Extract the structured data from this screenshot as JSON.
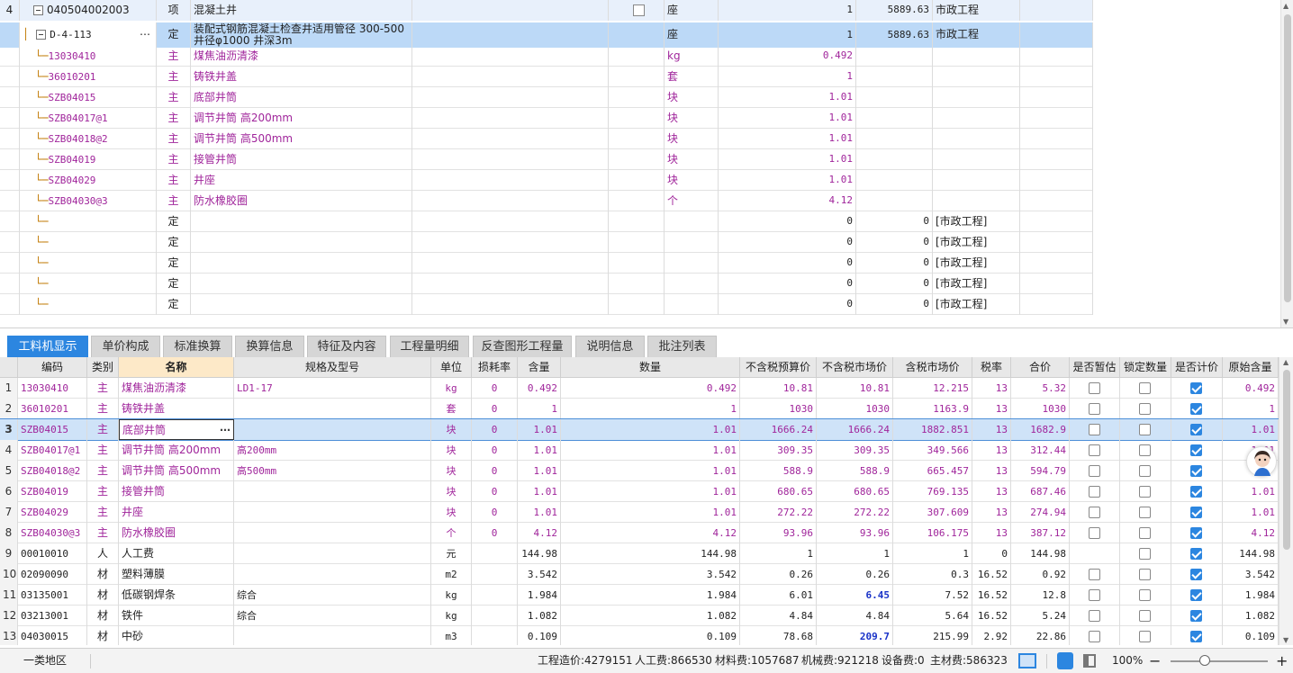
{
  "top_grid": {
    "rows": [
      {
        "no": "4",
        "code": "040504002003",
        "type": "项",
        "name": "混凝土井",
        "unit": "座",
        "qty": "1",
        "price": "5889.63",
        "category": "市政工程",
        "has_box": true,
        "kind": "parent"
      },
      {
        "no": "",
        "code": "D-4-113",
        "type": "定",
        "name_l1": "装配式钢筋混凝土检查井适用管径 300-500",
        "name_l2": "井径φ1000 井深3m",
        "unit": "座",
        "qty": "1",
        "price": "5889.63",
        "category": "市政工程",
        "kind": "selected"
      },
      {
        "code": "13030410",
        "type": "主",
        "name": "煤焦油沥清漆",
        "unit": "kg",
        "qty": "0.492",
        "kind": "mat"
      },
      {
        "code": "36010201",
        "type": "主",
        "name": "铸铁井盖",
        "unit": "套",
        "qty": "1",
        "kind": "mat"
      },
      {
        "code": "SZB04015",
        "type": "主",
        "name": "底部井筒",
        "unit": "块",
        "qty": "1.01",
        "kind": "mat"
      },
      {
        "code": "SZB04017@1",
        "type": "主",
        "name": "调节井筒 高200mm",
        "unit": "块",
        "qty": "1.01",
        "kind": "mat"
      },
      {
        "code": "SZB04018@2",
        "type": "主",
        "name": "调节井筒 高500mm",
        "unit": "块",
        "qty": "1.01",
        "kind": "mat"
      },
      {
        "code": "SZB04019",
        "type": "主",
        "name": "接管井筒",
        "unit": "块",
        "qty": "1.01",
        "kind": "mat"
      },
      {
        "code": "SZB04029",
        "type": "主",
        "name": "井座",
        "unit": "块",
        "qty": "1.01",
        "kind": "mat"
      },
      {
        "code": "SZB04030@3",
        "type": "主",
        "name": "防水橡胶圈",
        "unit": "个",
        "qty": "4.12",
        "kind": "mat"
      },
      {
        "type": "定",
        "qty": "0",
        "price": "0",
        "category": "[市政工程]",
        "kind": "empty"
      },
      {
        "type": "定",
        "qty": "0",
        "price": "0",
        "category": "[市政工程]",
        "kind": "empty"
      },
      {
        "type": "定",
        "qty": "0",
        "price": "0",
        "category": "[市政工程]",
        "kind": "empty"
      },
      {
        "type": "定",
        "qty": "0",
        "price": "0",
        "category": "[市政工程]",
        "kind": "empty"
      },
      {
        "type": "定",
        "qty": "0",
        "price": "0",
        "category": "[市政工程]",
        "kind": "empty"
      }
    ]
  },
  "tabs": [
    "工料机显示",
    "单价构成",
    "标准换算",
    "换算信息",
    "特征及内容",
    "工程量明细",
    "反查图形工程量",
    "说明信息",
    "批注列表"
  ],
  "bottom_grid": {
    "headers": [
      "编码",
      "类别",
      "名称",
      "规格及型号",
      "单位",
      "损耗率",
      "含量",
      "数量",
      "不含税预算价",
      "不含税市场价",
      "含税市场价",
      "税率",
      "合价",
      "是否暂估",
      "锁定数量",
      "是否计价",
      "原始含量"
    ],
    "rows": [
      {
        "n": "1",
        "code": "13030410",
        "cat": "主",
        "name": "煤焦油沥清漆",
        "spec": "LD1-17",
        "unit": "kg",
        "loss": "0",
        "content": "0.492",
        "qty": "0.492",
        "p1": "10.81",
        "p2": "10.81",
        "p3": "12.215",
        "tax": "13",
        "total": "5.32",
        "est": false,
        "lock": false,
        "calc": true,
        "orig": "0.492",
        "mag": true
      },
      {
        "n": "2",
        "code": "36010201",
        "cat": "主",
        "name": "铸铁井盖",
        "spec": "",
        "unit": "套",
        "loss": "0",
        "content": "1",
        "qty": "1",
        "p1": "1030",
        "p2": "1030",
        "p3": "1163.9",
        "tax": "13",
        "total": "1030",
        "est": false,
        "lock": false,
        "calc": true,
        "orig": "1",
        "mag": true
      },
      {
        "n": "3",
        "code": "SZB04015",
        "cat": "主",
        "name": "底部井筒",
        "spec": "",
        "unit": "块",
        "loss": "0",
        "content": "1.01",
        "qty": "1.01",
        "p1": "1666.24",
        "p2": "1666.24",
        "p3": "1882.851",
        "tax": "13",
        "total": "1682.9",
        "est": false,
        "lock": false,
        "calc": true,
        "orig": "1.01",
        "mag": true,
        "sel": true
      },
      {
        "n": "4",
        "code": "SZB04017@1",
        "cat": "主",
        "name": "调节井筒 高200mm",
        "spec": "高200mm",
        "unit": "块",
        "loss": "0",
        "content": "1.01",
        "qty": "1.01",
        "p1": "309.35",
        "p2": "309.35",
        "p3": "349.566",
        "tax": "13",
        "total": "312.44",
        "est": false,
        "lock": false,
        "calc": true,
        "orig": "1.01",
        "mag": true
      },
      {
        "n": "5",
        "code": "SZB04018@2",
        "cat": "主",
        "name": "调节井筒 高500mm",
        "spec": "高500mm",
        "unit": "块",
        "loss": "0",
        "content": "1.01",
        "qty": "1.01",
        "p1": "588.9",
        "p2": "588.9",
        "p3": "665.457",
        "tax": "13",
        "total": "594.79",
        "est": false,
        "lock": false,
        "calc": true,
        "orig": "",
        "mag": true
      },
      {
        "n": "6",
        "code": "SZB04019",
        "cat": "主",
        "name": "接管井筒",
        "spec": "",
        "unit": "块",
        "loss": "0",
        "content": "1.01",
        "qty": "1.01",
        "p1": "680.65",
        "p2": "680.65",
        "p3": "769.135",
        "tax": "13",
        "total": "687.46",
        "est": false,
        "lock": false,
        "calc": true,
        "orig": "1.01",
        "mag": true
      },
      {
        "n": "7",
        "code": "SZB04029",
        "cat": "主",
        "name": "井座",
        "spec": "",
        "unit": "块",
        "loss": "0",
        "content": "1.01",
        "qty": "1.01",
        "p1": "272.22",
        "p2": "272.22",
        "p3": "307.609",
        "tax": "13",
        "total": "274.94",
        "est": false,
        "lock": false,
        "calc": true,
        "orig": "1.01",
        "mag": true
      },
      {
        "n": "8",
        "code": "SZB04030@3",
        "cat": "主",
        "name": "防水橡胶圈",
        "spec": "",
        "unit": "个",
        "loss": "0",
        "content": "4.12",
        "qty": "4.12",
        "p1": "93.96",
        "p2": "93.96",
        "p3": "106.175",
        "tax": "13",
        "total": "387.12",
        "est": false,
        "lock": false,
        "calc": true,
        "orig": "4.12",
        "mag": true
      },
      {
        "n": "9",
        "code": "00010010",
        "cat": "人",
        "name": "人工费",
        "spec": "",
        "unit": "元",
        "loss": "",
        "content": "144.98",
        "qty": "144.98",
        "p1": "1",
        "p2": "1",
        "p3": "1",
        "tax": "0",
        "total": "144.98",
        "est": null,
        "lock": false,
        "calc": true,
        "orig": "144.98",
        "mag": false
      },
      {
        "n": "10",
        "code": "02090090",
        "cat": "材",
        "name": "塑料薄膜",
        "spec": "",
        "unit": "m2",
        "loss": "",
        "content": "3.542",
        "qty": "3.542",
        "p1": "0.26",
        "p2": "0.26",
        "p3": "0.3",
        "tax": "16.52",
        "total": "0.92",
        "est": false,
        "lock": false,
        "calc": true,
        "orig": "3.542",
        "mag": false
      },
      {
        "n": "11",
        "code": "03135001",
        "cat": "材",
        "name": "低碳钢焊条",
        "spec": "综合",
        "unit": "kg",
        "loss": "",
        "content": "1.984",
        "qty": "1.984",
        "p1": "6.01",
        "p2": "6.45",
        "p3": "7.52",
        "tax": "16.52",
        "total": "12.8",
        "est": false,
        "lock": false,
        "calc": true,
        "orig": "1.984",
        "mag": false,
        "p2blue": true
      },
      {
        "n": "12",
        "code": "03213001",
        "cat": "材",
        "name": "铁件",
        "spec": "综合",
        "unit": "kg",
        "loss": "",
        "content": "1.082",
        "qty": "1.082",
        "p1": "4.84",
        "p2": "4.84",
        "p3": "5.64",
        "tax": "16.52",
        "total": "5.24",
        "est": false,
        "lock": false,
        "calc": true,
        "orig": "1.082",
        "mag": false
      },
      {
        "n": "13",
        "code": "04030015",
        "cat": "材",
        "name": "中砂",
        "spec": "",
        "unit": "m3",
        "loss": "",
        "content": "0.109",
        "qty": "0.109",
        "p1": "78.68",
        "p2": "209.7",
        "p3": "215.99",
        "tax": "2.92",
        "total": "22.86",
        "est": false,
        "lock": false,
        "calc": true,
        "orig": "0.109",
        "mag": false,
        "p2blue": true
      }
    ]
  },
  "status": {
    "region": "一类地区",
    "cost": "工程造价:4279151",
    "labor": "人工费:866530",
    "material": "材料费:1057687",
    "machine": "机械费:921218",
    "equipment": "设备费:0",
    "main_material": "主材费:586323",
    "zoom": "100%"
  }
}
